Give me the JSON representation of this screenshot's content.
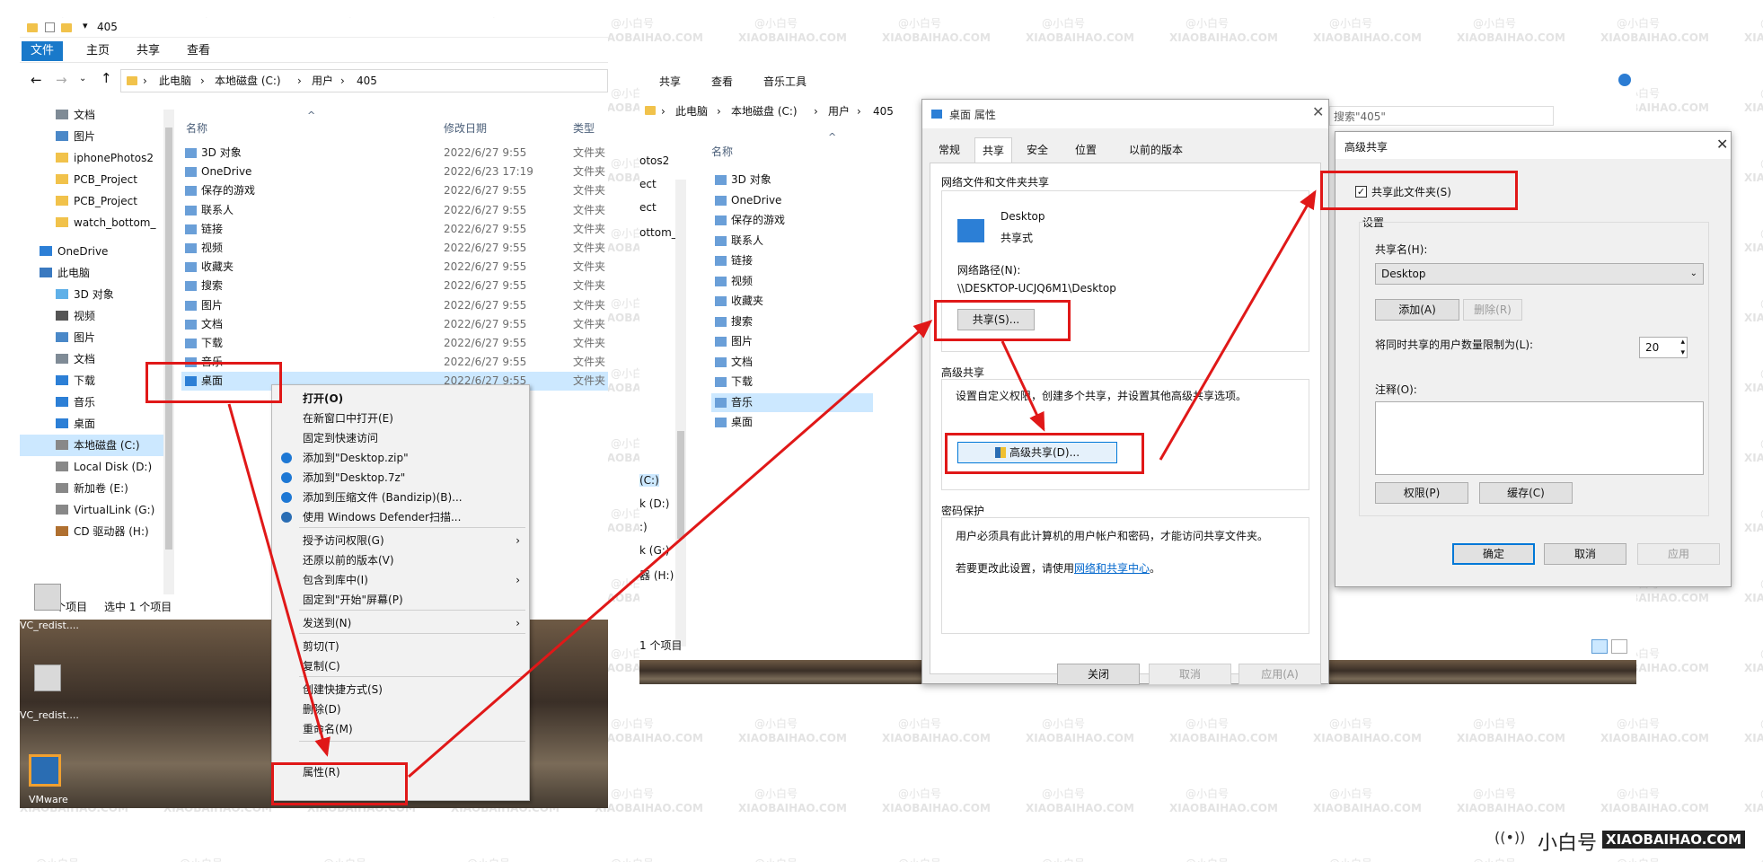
{
  "explorer1": {
    "title": "405",
    "ribbon_tabs": [
      "文件",
      "主页",
      "共享",
      "查看"
    ],
    "breadcrumb": [
      "此电脑",
      "本地磁盘 (C:)",
      "用户",
      "405"
    ],
    "nav_items": [
      {
        "label": "文档",
        "icon": "document-icon"
      },
      {
        "label": "图片",
        "icon": "pictures-icon"
      },
      {
        "label": "iphonePhotos2",
        "icon": "folder-icon"
      },
      {
        "label": "PCB_Project",
        "icon": "folder-icon"
      },
      {
        "label": "PCB_Project",
        "icon": "folder-icon"
      },
      {
        "label": "watch_bottom_",
        "icon": "folder-icon"
      },
      {
        "label": "OneDrive",
        "icon": "onedrive-icon"
      },
      {
        "label": "此电脑",
        "icon": "computer-icon"
      },
      {
        "label": "3D 对象",
        "icon": "3d-objects-icon"
      },
      {
        "label": "视频",
        "icon": "video-icon"
      },
      {
        "label": "图片",
        "icon": "pictures-icon"
      },
      {
        "label": "文档",
        "icon": "document-icon"
      },
      {
        "label": "下载",
        "icon": "download-icon"
      },
      {
        "label": "音乐",
        "icon": "music-icon"
      },
      {
        "label": "桌面",
        "icon": "desktop-icon"
      },
      {
        "label": "本地磁盘 (C:)",
        "icon": "drive-icon"
      },
      {
        "label": "Local Disk (D:)",
        "icon": "drive-icon"
      },
      {
        "label": "新加卷 (E:)",
        "icon": "drive-icon"
      },
      {
        "label": "VirtualLink (G:)",
        "icon": "drive-icon"
      },
      {
        "label": "CD 驱动器 (H:)",
        "icon": "cd-drive-icon"
      }
    ],
    "columns": [
      "名称",
      "修改日期",
      "类型"
    ],
    "files": [
      {
        "name": "3D 对象",
        "date": "2022/6/27 9:55",
        "type": "文件夹"
      },
      {
        "name": "OneDrive",
        "date": "2022/6/23 17:19",
        "type": "文件夹"
      },
      {
        "name": "保存的游戏",
        "date": "2022/6/27 9:55",
        "type": "文件夹"
      },
      {
        "name": "联系人",
        "date": "2022/6/27 9:55",
        "type": "文件夹"
      },
      {
        "name": "链接",
        "date": "2022/6/27 9:55",
        "type": "文件夹"
      },
      {
        "name": "视频",
        "date": "2022/6/27 9:55",
        "type": "文件夹"
      },
      {
        "name": "收藏夹",
        "date": "2022/6/27 9:55",
        "type": "文件夹"
      },
      {
        "name": "搜索",
        "date": "2022/6/27 9:55",
        "type": "文件夹"
      },
      {
        "name": "图片",
        "date": "2022/6/27 9:55",
        "type": "文件夹"
      },
      {
        "name": "文档",
        "date": "2022/6/27 9:55",
        "type": "文件夹"
      },
      {
        "name": "下载",
        "date": "2022/6/27 9:55",
        "type": "文件夹"
      },
      {
        "name": "音乐",
        "date": "2022/6/27 9:55",
        "type": "文件夹"
      },
      {
        "name": "桌面",
        "date": "2022/6/27 9:55",
        "type": "文件夹"
      }
    ],
    "status_count": "13 个项目",
    "status_selected": "选中 1 个项目"
  },
  "context_menu": [
    "打开(O)",
    "在新窗口中打开(E)",
    "固定到快速访问",
    "添加到\"Desktop.zip\"",
    "添加到\"Desktop.7z\"",
    "添加到压缩文件 (Bandizip)(B)...",
    "使用 Windows Defender扫描...",
    "授予访问权限(G)",
    "还原以前的版本(V)",
    "包含到库中(I)",
    "固定到\"开始\"屏幕(P)",
    "发送到(N)",
    "剪切(T)",
    "复制(C)",
    "创建快捷方式(S)",
    "删除(D)",
    "重命名(M)",
    "属性(R)"
  ],
  "desktop_icons": [
    "VC_redist....",
    "VC_redist....",
    "VMware"
  ],
  "explorer2": {
    "ribbon_tabs": [
      "共享",
      "查看",
      "音乐工具"
    ],
    "breadcrumb": [
      "此电脑",
      "本地磁盘 (C:)",
      "用户",
      "405"
    ],
    "nav_fragments": [
      "otos2",
      "ect",
      "ect",
      "ottom_",
      "(C:)",
      "k (D:)",
      ":)",
      "k (G:)",
      "器 (H:)"
    ],
    "column": "名称",
    "files": [
      "3D 对象",
      "OneDrive",
      "保存的游戏",
      "联系人",
      "链接",
      "视频",
      "收藏夹",
      "搜索",
      "图片",
      "文档",
      "下载",
      "音乐",
      "桌面"
    ],
    "status": "1 个项目",
    "search_fragment": "搜索\"405\""
  },
  "properties_dialog": {
    "title": "桌面 属性",
    "tabs": [
      "常规",
      "共享",
      "安全",
      "位置",
      "以前的版本"
    ],
    "net_share_header": "网络文件和文件夹共享",
    "folder_name": "Desktop",
    "share_state": "共享式",
    "net_path_label": "网络路径(N):",
    "net_path": "\\\\DESKTOP-UCJQ6M1\\Desktop",
    "share_button": "共享(S)...",
    "adv_header": "高级共享",
    "adv_desc": "设置自定义权限，创建多个共享，并设置其他高级共享选项。",
    "adv_button": "高级共享(D)...",
    "pwd_header": "密码保护",
    "pwd_desc": "用户必须具有此计算机的用户帐户和密码，才能访问共享文件夹。",
    "pwd_change_prefix": "若要更改此设置，请使用",
    "pwd_link": "网络和共享中心",
    "pwd_change_suffix": "。",
    "buttons": [
      "关闭",
      "取消",
      "应用(A)"
    ]
  },
  "adv_dialog": {
    "title": "高级共享",
    "share_checkbox": "共享此文件夹(S)",
    "settings_label": "设置",
    "share_name_label": "共享名(H):",
    "share_name_value": "Desktop",
    "add_button": "添加(A)",
    "remove_button": "删除(R)",
    "limit_label": "将同时共享的用户数量限制为(L):",
    "limit_value": "20",
    "comment_label": "注释(O):",
    "perm_button": "权限(P)",
    "cache_button": "缓存(C)",
    "ok_button": "确定",
    "cancel_button": "取消",
    "apply_button": "应用"
  },
  "watermark": {
    "cn": "@小白号",
    "en": "XIAOBAIHAO.COM"
  },
  "brand": {
    "cn": "小白号",
    "en": "XIAOBAIHAO.COM"
  },
  "colors": {
    "annotation_red": "#e01818",
    "selection_blue": "#cce8ff",
    "ribbon_blue": "#1979ca"
  }
}
